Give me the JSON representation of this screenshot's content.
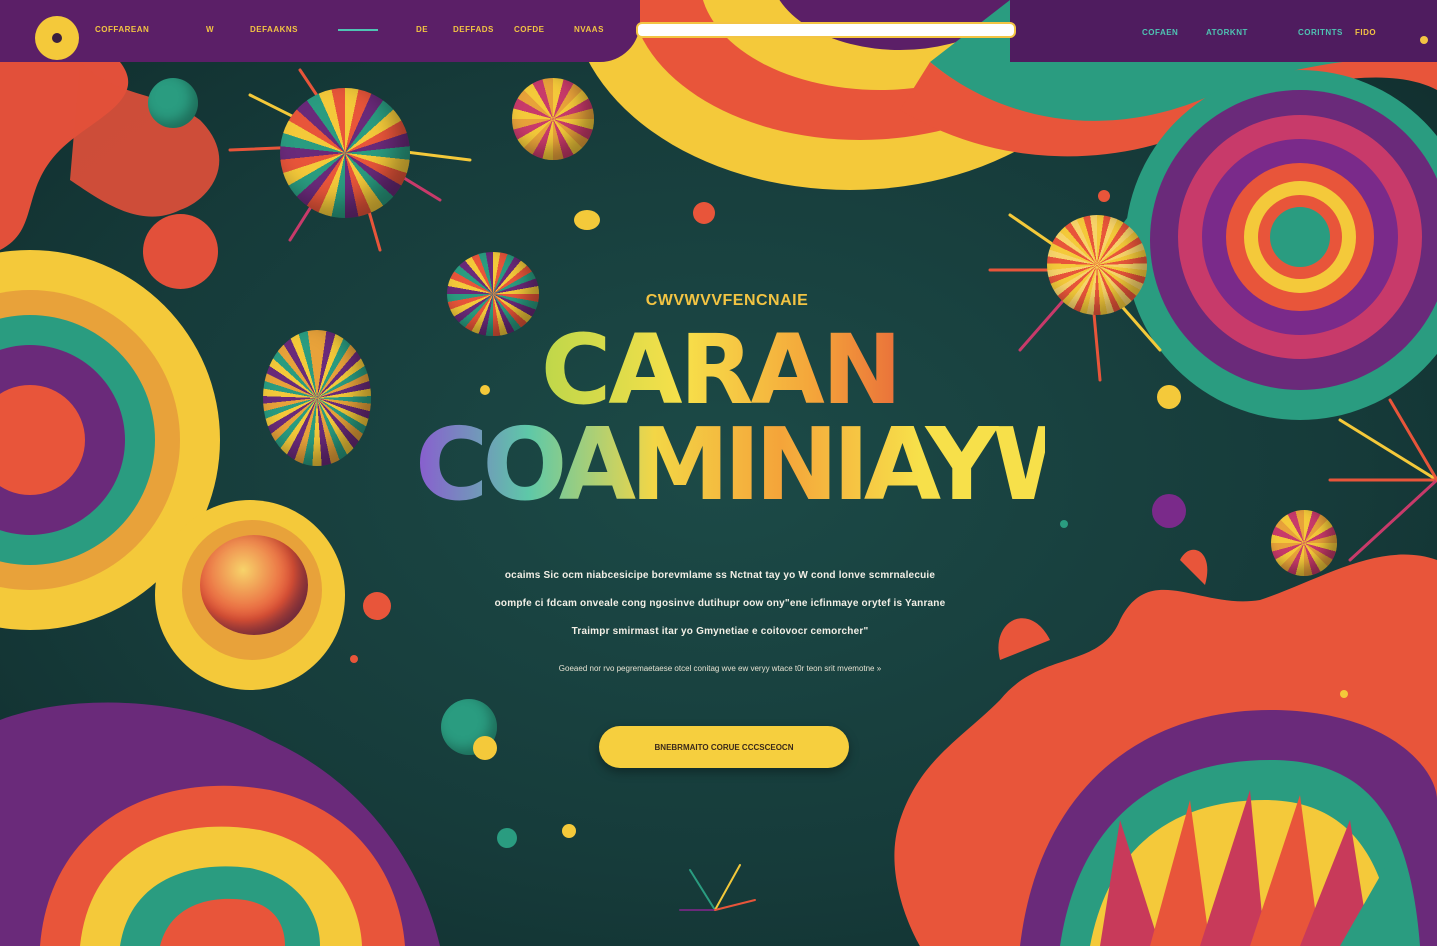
{
  "nav": {
    "brand": "COFFAREAN",
    "left_items": [
      "W",
      "DEFAAKNS",
      "",
      "DE",
      "DEFFADS",
      "COFDE",
      "NVAAS"
    ],
    "right_items": [
      "COFAEN",
      "ATORKNT",
      "CORITNTS",
      "FIDO"
    ]
  },
  "hero": {
    "kicker": "CWVWVVFENCNAIE",
    "title_line1": "CARAN",
    "title_line2": "COAMINIAYW",
    "body_lines": [
      "ocaims Sic ocm niabcesicipe borevmlame ss Nctnat tay yo W cond lonve scmrnalecuie",
      "oompfe ci fdcam onveale cong ngosinve dutihupr oow ony\"ene icfinmaye orytef is Yanrane",
      "Traimpr smirmast itar yo Gmynetiae e coitovocr cemorcher\""
    ],
    "small_line": "Goeaed nor rvo pegremaetaese otcel conitag wve ew veryy wtace t0r teon srit mvemotne »",
    "cta_label": "BNEBRMAITO CORUE CCCSCEOCN"
  },
  "colors": {
    "background": "#173f3e",
    "yellow": "#f6cf3e",
    "orange": "#e8553a",
    "purple": "#6a2a7a",
    "green": "#2a9c80",
    "teal": "#1c4a47"
  }
}
